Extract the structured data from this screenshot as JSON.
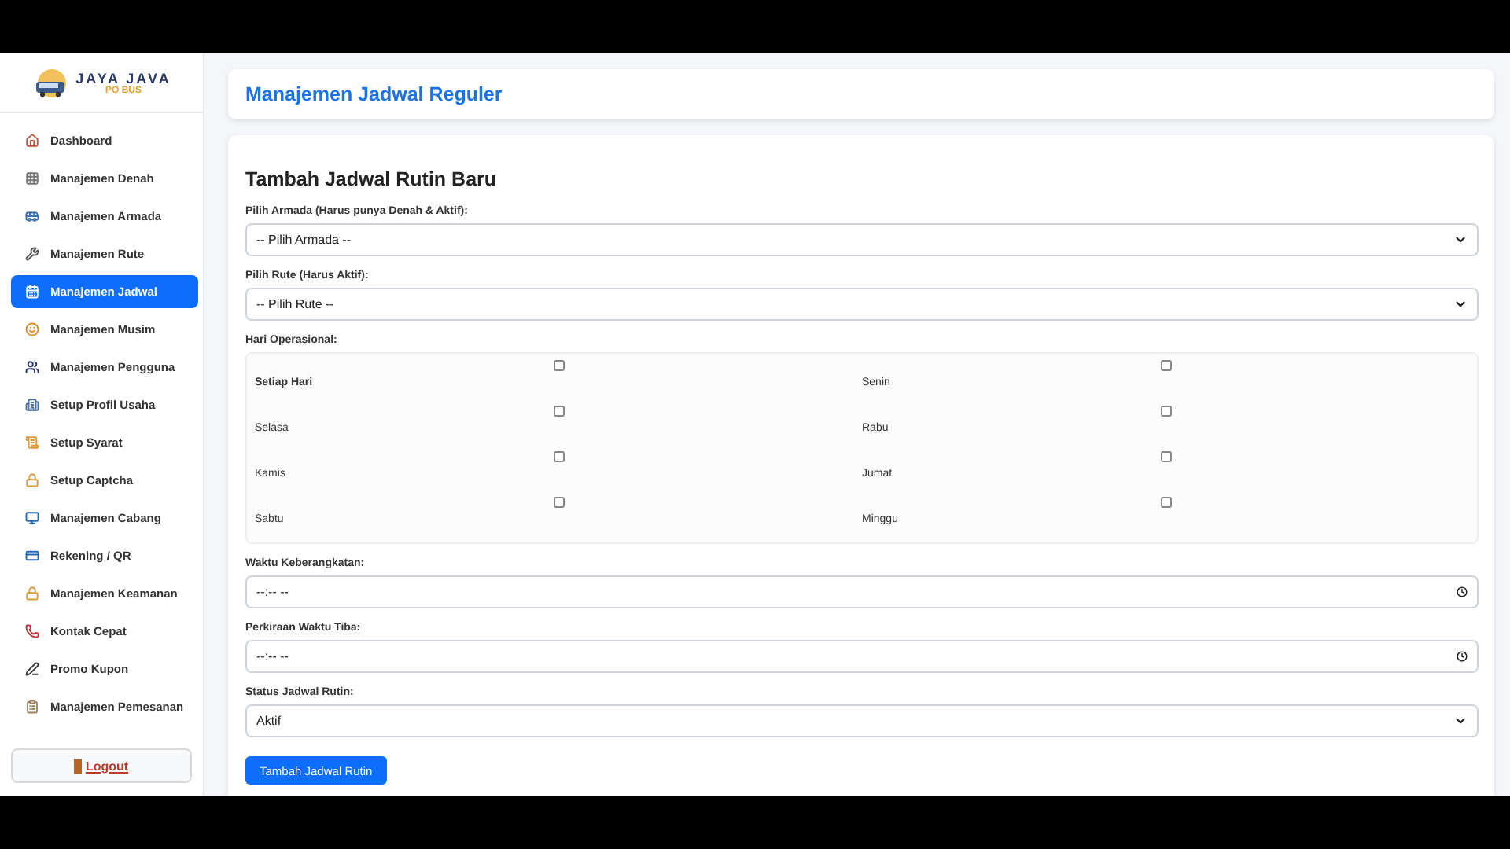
{
  "sidebar": {
    "logo": {
      "title": "JAYA JAVA",
      "subtitle": "PO BUS"
    },
    "items": [
      {
        "label": "Dashboard",
        "selected": false
      },
      {
        "label": "Manajemen Denah",
        "selected": false
      },
      {
        "label": "Manajemen Armada",
        "selected": false
      },
      {
        "label": "Manajemen Rute",
        "selected": false
      },
      {
        "label": "Manajemen Jadwal",
        "selected": true
      },
      {
        "label": "Manajemen Musim",
        "selected": false
      },
      {
        "label": "Manajemen Pengguna",
        "selected": false
      },
      {
        "label": "Setup Profil Usaha",
        "selected": false
      },
      {
        "label": "Setup Syarat",
        "selected": false
      },
      {
        "label": "Setup Captcha",
        "selected": false
      },
      {
        "label": "Manajemen Cabang",
        "selected": false
      },
      {
        "label": "Rekening / QR",
        "selected": false
      },
      {
        "label": "Manajemen Keamanan",
        "selected": false
      },
      {
        "label": "Kontak Cepat",
        "selected": false
      },
      {
        "label": "Promo Kupon",
        "selected": false
      },
      {
        "label": "Manajemen Pemesanan",
        "selected": false
      }
    ],
    "logout": "Logout"
  },
  "header": {
    "title": "Manajemen Jadwal Reguler"
  },
  "form": {
    "title": "Tambah Jadwal Rutin Baru",
    "fields": [
      {
        "kind": "select",
        "label": "Pilih Armada (Harus punya Denah & Aktif):",
        "value": "-- Pilih Armada --"
      },
      {
        "kind": "select",
        "label": "Pilih Rute (Harus Aktif):",
        "value": "-- Pilih Rute --"
      },
      {
        "kind": "days",
        "label": "Hari Operasional:",
        "days": [
          {
            "label": "Setiap Hari",
            "bold": true,
            "checked": false
          },
          {
            "label": "Senin",
            "bold": false,
            "checked": false
          },
          {
            "label": "Selasa",
            "bold": false,
            "checked": false
          },
          {
            "label": "Rabu",
            "bold": false,
            "checked": false
          },
          {
            "label": "Kamis",
            "bold": false,
            "checked": false
          },
          {
            "label": "Jumat",
            "bold": false,
            "checked": false
          },
          {
            "label": "Sabtu",
            "bold": false,
            "checked": false
          },
          {
            "label": "Minggu",
            "bold": false,
            "checked": false
          }
        ]
      },
      {
        "kind": "time",
        "label": "Waktu Keberangkatan:",
        "value": "--:-- --"
      },
      {
        "kind": "time",
        "label": "Perkiraan Waktu Tiba:",
        "value": "--:-- --"
      },
      {
        "kind": "select",
        "label": "Status Jadwal Rutin:",
        "value": "Aktif"
      }
    ],
    "submit": "Tambah Jadwal Rutin"
  }
}
